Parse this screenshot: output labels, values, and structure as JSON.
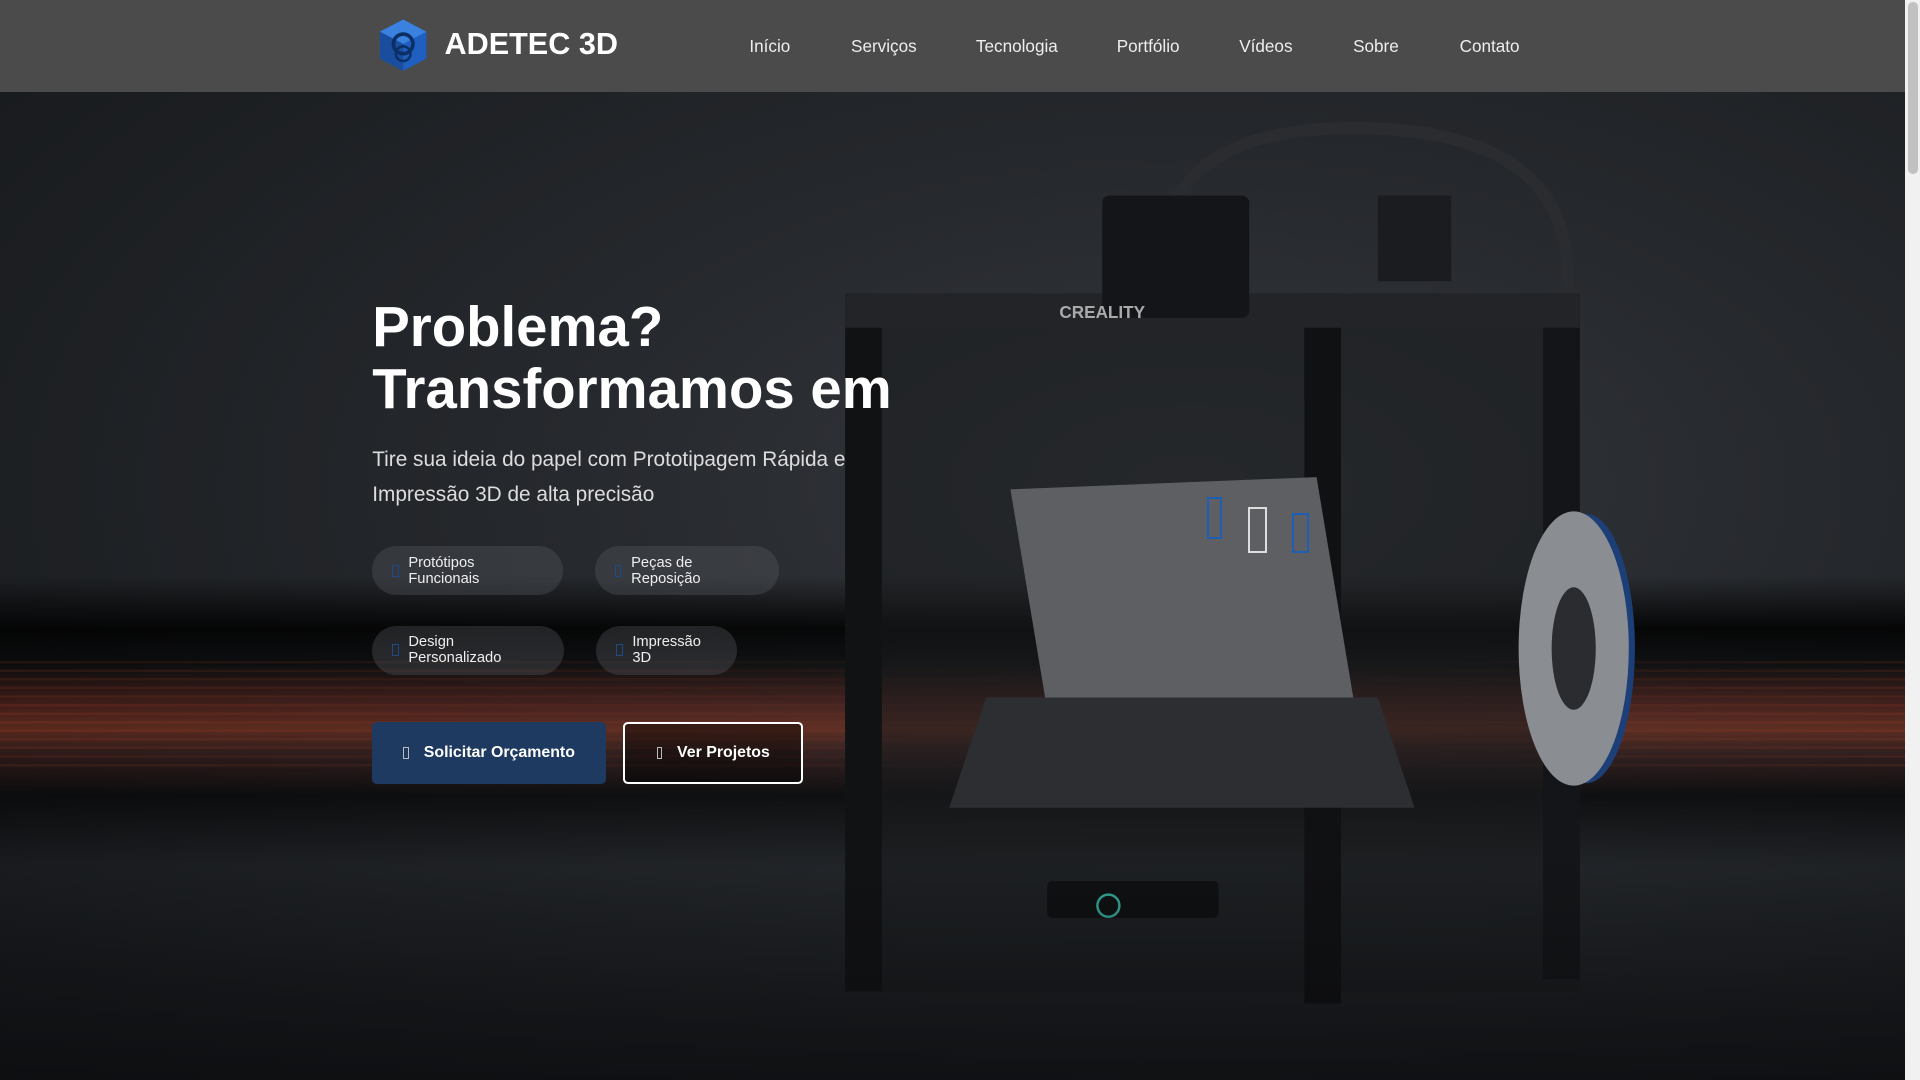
{
  "nav": {
    "brand": "ADETEC 3D",
    "links": [
      "Início",
      "Serviços",
      "Tecnologia",
      "Portfólio",
      "Vídeos",
      "Sobre",
      "Contato"
    ]
  },
  "hero": {
    "title": "Problema? Transformamos em",
    "subtitle": "Tire sua ideia do papel com Prototipagem Rápida e Impressão 3D de alta precisão",
    "tags": [
      "Protótipos Funcionais",
      "Peças de Reposição",
      "Design Personalizado",
      "Impressão 3D"
    ],
    "primary_button": "Solicitar Orçamento",
    "secondary_button": "Ver Projetos",
    "printer_label": "CREALITY"
  },
  "colors": {
    "nav_bg": "#4b4b4b",
    "primary": "#1e3a61",
    "accent_blue": "#1e5fb5"
  }
}
